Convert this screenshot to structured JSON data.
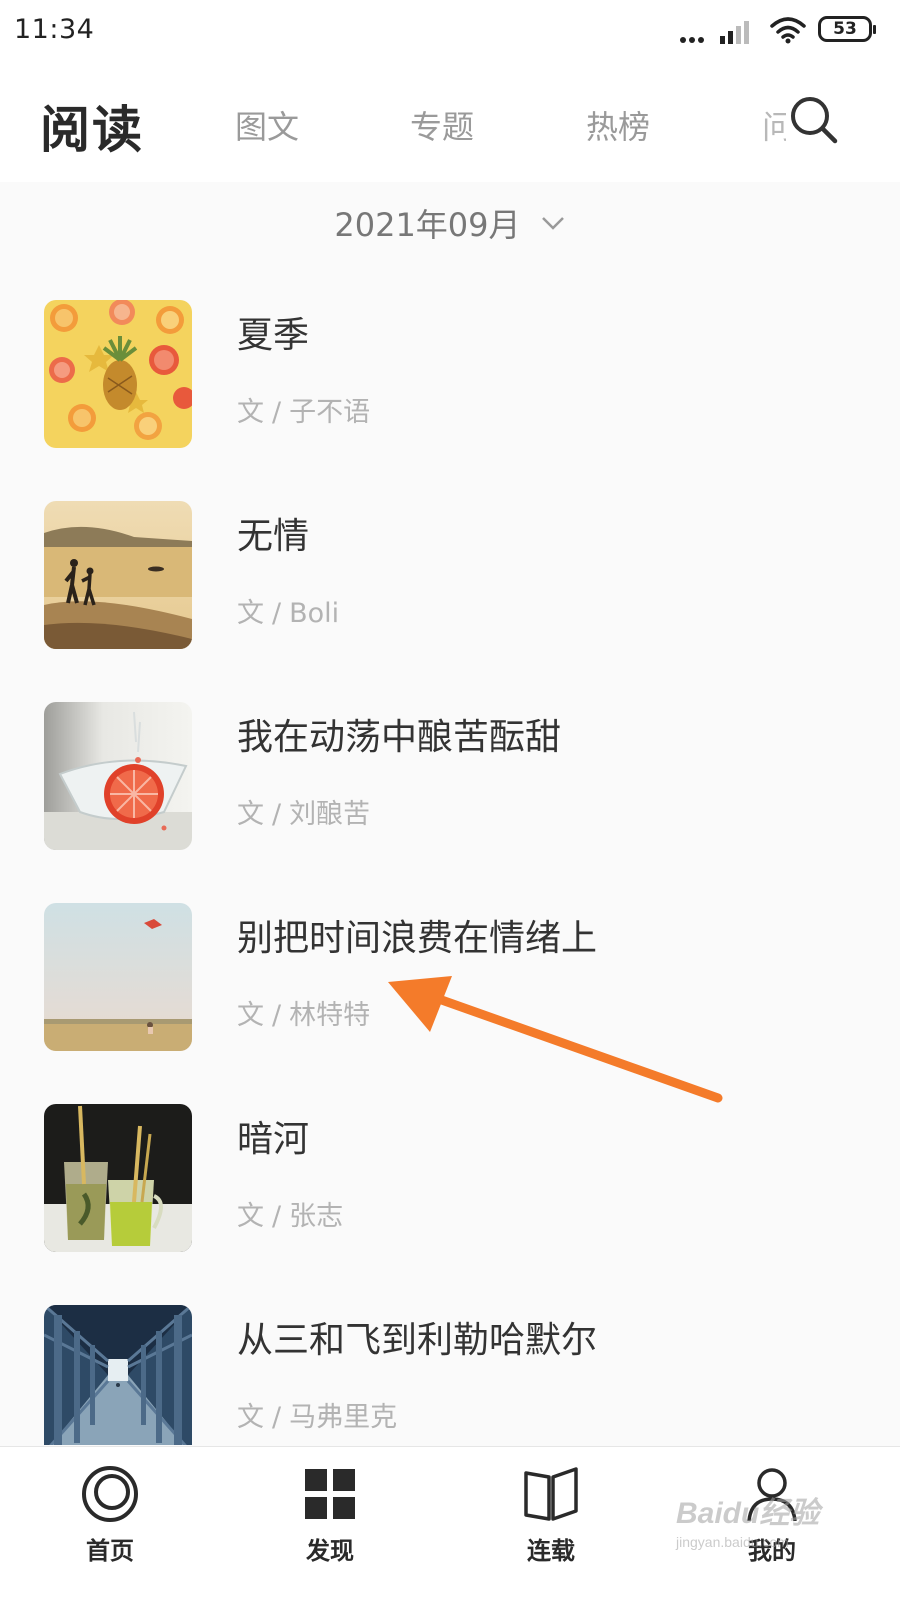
{
  "status_bar": {
    "time": "11:34",
    "battery": "53"
  },
  "header": {
    "title": "阅读",
    "tabs": [
      "图文",
      "专题",
      "热榜",
      "问"
    ]
  },
  "date_picker": {
    "label": "2021年09月"
  },
  "articles": [
    {
      "title": "夏季",
      "author_prefix": "文",
      "separator": "/",
      "author": "子不语"
    },
    {
      "title": "无情",
      "author_prefix": "文",
      "separator": "/",
      "author": "Boli"
    },
    {
      "title": "我在动荡中酿苦酝甜",
      "author_prefix": "文",
      "separator": "/",
      "author": "刘酿苦"
    },
    {
      "title": "别把时间浪费在情绪上",
      "author_prefix": "文",
      "separator": "/",
      "author": "林特特"
    },
    {
      "title": "暗河",
      "author_prefix": "文",
      "separator": "/",
      "author": "张志"
    },
    {
      "title": "从三和飞到利勒哈默尔",
      "author_prefix": "文",
      "separator": "/",
      "author": "马弗里克"
    }
  ],
  "bottom_nav": {
    "items": [
      {
        "label": "首页",
        "icon": "home-circle-icon"
      },
      {
        "label": "发现",
        "icon": "grid-icon"
      },
      {
        "label": "连载",
        "icon": "open-book-icon"
      },
      {
        "label": "我的",
        "icon": "user-icon"
      }
    ]
  },
  "watermark": {
    "main": "Baidu经验",
    "sub": "jingyan.baidu.com"
  },
  "colors": {
    "annotation_arrow": "#f47b2a",
    "background": "#fafafa",
    "secondary_text": "#b3b3b3"
  }
}
